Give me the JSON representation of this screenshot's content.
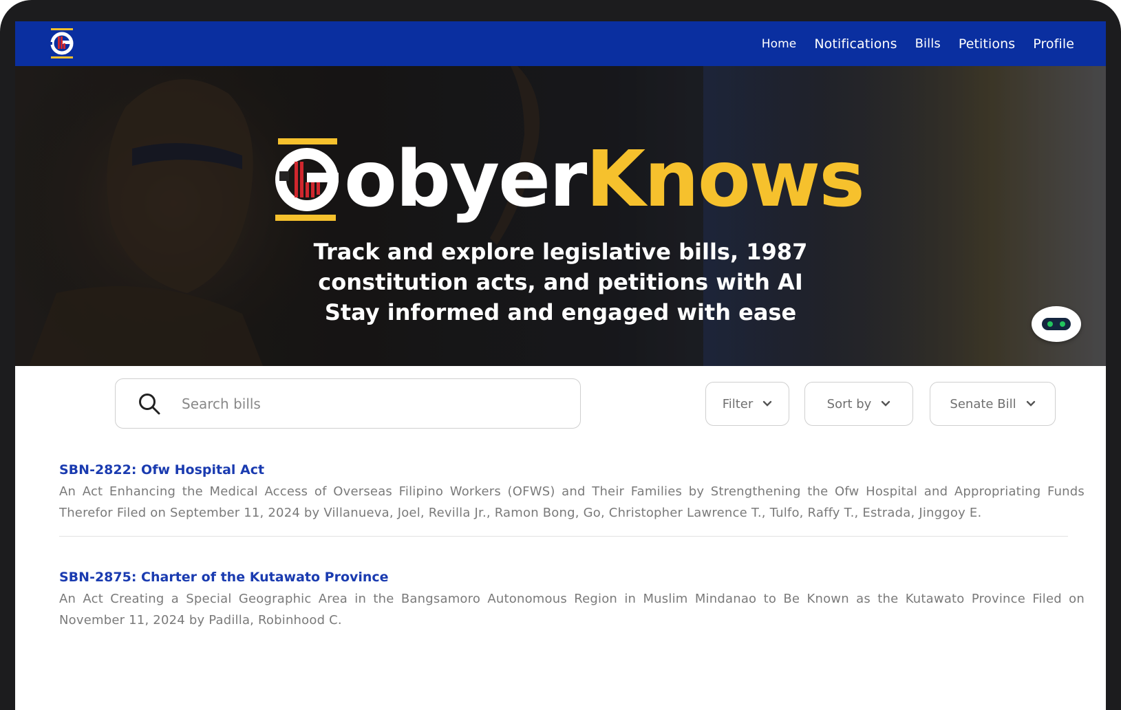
{
  "nav": {
    "links": [
      "Home",
      "Notifications",
      "Bills",
      "Petitions",
      "Profile"
    ],
    "active": "Bills",
    "logo_letter": "G",
    "color": "#0a2fa0"
  },
  "hero": {
    "brand_white": "obyer",
    "brand_yellow": "Knows",
    "brand_letter": "G",
    "tagline": [
      "Track and explore legislative bills, 1987",
      "constitution acts, and petitions with AI",
      "Stay informed and engaged with ease"
    ],
    "accent_color": "#f6c12d",
    "chat_icon": "chatbot-icon"
  },
  "search": {
    "placeholder": "Search bills",
    "icon": "search-icon"
  },
  "filters": {
    "filter_label": "Filter",
    "sort_label": "Sort by",
    "type_label": "Senate Bill"
  },
  "bills": [
    {
      "title": "SBN-2822: Ofw Hospital Act",
      "description": "An Act Enhancing the Medical Access of Overseas Filipino Workers (OFWS) and Their Families by Strengthening the Ofw Hospital and Appropriating Funds Therefor Filed on September 11, 2024 by Villanueva, Joel, Revilla Jr., Ramon Bong, Go, Christopher Lawrence T., Tulfo, Raffy T., Estrada, Jinggoy E."
    },
    {
      "title": "SBN-2875: Charter of the Kutawato Province",
      "description": "An Act Creating a Special Geographic Area in the Bangsamoro Autonomous Region in Muslim Mindanao to Be Known as the Kutawato Province Filed on November 11, 2024 by Padilla, Robinhood C."
    }
  ]
}
